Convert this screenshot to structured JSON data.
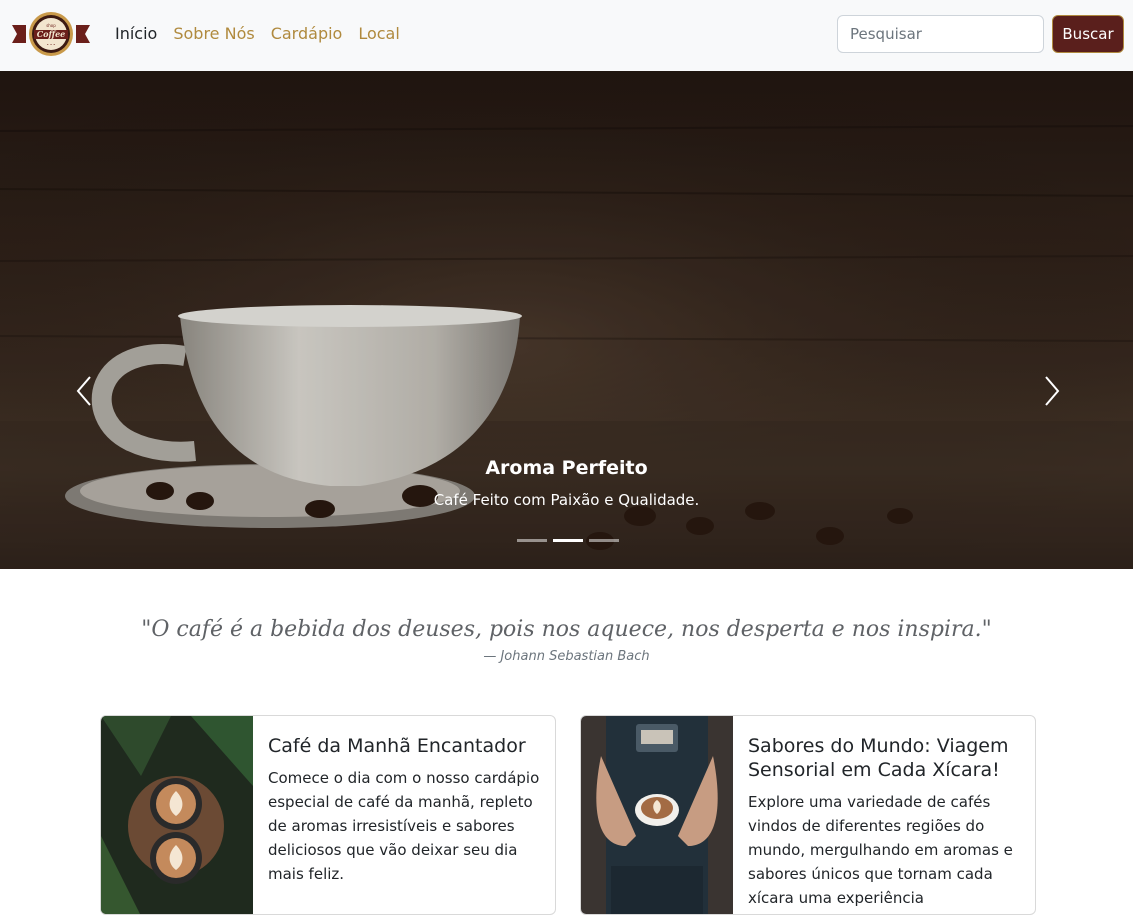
{
  "navbar": {
    "logo_alt": "Coffee Shop",
    "links": [
      {
        "label": "Início",
        "active": true
      },
      {
        "label": "Sobre Nós",
        "active": false
      },
      {
        "label": "Cardápio",
        "active": false
      },
      {
        "label": "Local",
        "active": false
      }
    ],
    "search_placeholder": "Pesquisar",
    "search_button": "Buscar"
  },
  "carousel": {
    "caption_title": "Aroma Perfeito",
    "caption_text": "Café Feito com Paixão e Qualidade.",
    "indicator_count": 3,
    "active_index": 1,
    "prev_icon": "chevron-left-icon",
    "next_icon": "chevron-right-icon"
  },
  "quote": {
    "text": "\"O café é a bebida dos deuses, pois nos aquece, nos desperta e nos inspira.\"",
    "author": "— Johann Sebastian Bach"
  },
  "cards": [
    {
      "title": "Café da Manhã Encantador",
      "text": "Comece o dia com o nosso cardápio especial de café da manhã, repleto de aromas irresistíveis e sabores deliciosos que vão deixar seu dia mais feliz."
    },
    {
      "title": "Sabores do Mundo: Viagem Sensorial em Cada Xícara!",
      "text": "Explore uma variedade de cafés vindos de diferentes regiões do mundo, mergulhando em aromas e sabores únicos que tornam cada xícara uma experiência inesquecível."
    }
  ],
  "colors": {
    "brand_gold": "#b08a3e",
    "brand_brown": "#5a1f1c",
    "navbar_bg": "#f8f9fa"
  }
}
